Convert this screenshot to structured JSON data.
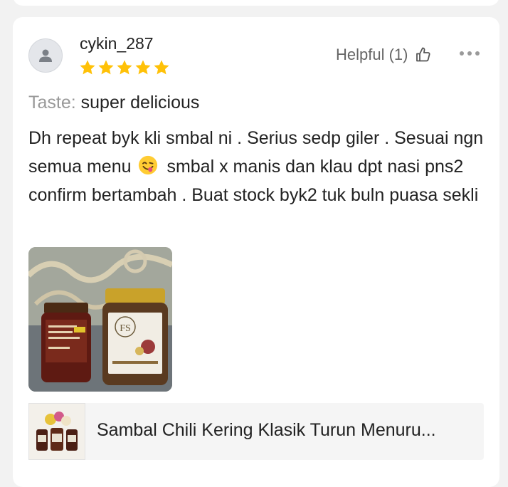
{
  "review": {
    "username": "cykin_287",
    "rating": 5,
    "rating_max": 5,
    "helpful_label": "Helpful (1)",
    "variation_label": "Taste:",
    "variation_value": "super delicious",
    "text_part1": "Dh repeat byk kli smbal ni . Serius sedp giler . Sesuai ngn semua menu",
    "text_part2": "smbal x manis dan klau dpt nasi pns2 confirm bertambah . Buat stock byk2 tuk buln puasa sekli",
    "photo_jar_label": "FS"
  },
  "product": {
    "name": "Sambal Chili Kering Klasik Turun Menuru..."
  },
  "icons": {
    "avatar": "person-icon",
    "helpful": "thumbs-up-icon",
    "more": "more-options-icon",
    "emoji": "face-savoring-food-emoji"
  },
  "colors": {
    "star": "#ffc107",
    "helpful_text": "#666666",
    "label_grey": "#999999"
  }
}
